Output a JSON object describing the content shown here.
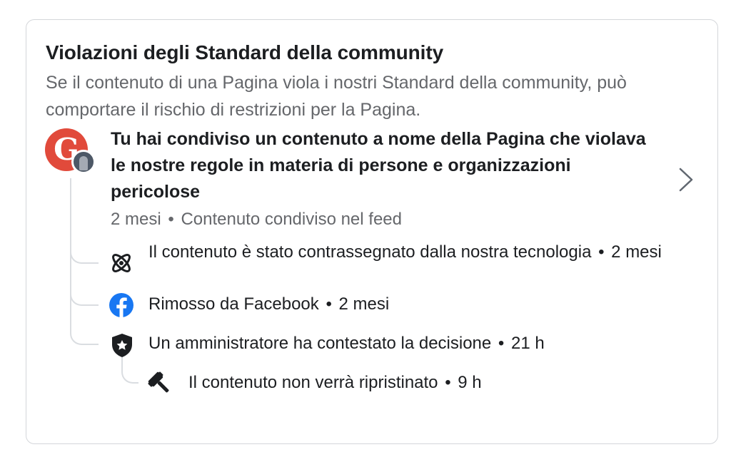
{
  "card": {
    "title": "Violazioni degli Standard della community",
    "subtitle": "Se il contenuto di una Pagina viola i nostri Standard della community, può comportare il rischio di restrizioni per la Pagina."
  },
  "violation": {
    "avatar_initial": "G",
    "headline": "Tu hai condiviso un contenuto a nome della Pagina che violava le nostre regole in materia di persone e organizzazioni pericolose",
    "meta_time": "2 mesi",
    "meta_separator": "•",
    "meta_location": "Contenuto condiviso nel feed",
    "chevron_icon": "chevron-right-icon"
  },
  "events": [
    {
      "icon": "atom-icon",
      "text": "Il contenuto è stato contrassegnato dalla nostra tecnologia",
      "time": "2 mesi"
    },
    {
      "icon": "facebook-icon",
      "text": "Rimosso da Facebook",
      "time": "2 mesi",
      "icon_color": "#1877f2"
    },
    {
      "icon": "admin-shield-icon",
      "text": "Un amministratore ha contestato la decisione",
      "time": "21 h"
    },
    {
      "icon": "gavel-icon",
      "text": "Il contenuto non verrà ripristinato",
      "time": "9 h"
    }
  ],
  "colors": {
    "text_primary": "#1c1e21",
    "text_secondary": "#65676b",
    "facebook_blue": "#1877f2",
    "avatar_red": "#e14a3b",
    "border": "#d4d6da"
  }
}
